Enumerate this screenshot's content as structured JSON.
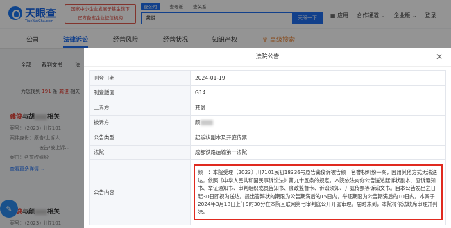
{
  "header": {
    "logo_text": "天眼查",
    "logo_sub": "TianYanCha.com",
    "stamp_line1": "国家中小企业发展子基金旗下",
    "stamp_line2": "官方备案企业征信机构",
    "search_tabs": [
      "查公司",
      "查老板",
      "查关系"
    ],
    "search_value": "龚俊",
    "search_button": "天眼一下",
    "nav": [
      "应用",
      "合作通道",
      "企业版",
      "登录"
    ]
  },
  "main_tabs": [
    "公司",
    "法律诉讼",
    "经营风险",
    "经营状况",
    "知识产权",
    "高级搜索"
  ],
  "left": {
    "filters": [
      "全部",
      "裁判文书",
      "法"
    ],
    "found": {
      "prefix": "为您找到",
      "count": "191",
      "mid": "条",
      "name": "龚俊",
      "suffix": "相关"
    },
    "cards": [
      {
        "title_hl": "龚俊",
        "title_rest": "与胡",
        "title_end": "相关",
        "lines": [
          "案号：（2023）川7101",
          "案件身份：原告/上诉人…",
          "被告/被上诉…",
          "案由：名誉权纠纷"
        ],
        "more": "查看更多详情"
      },
      {
        "title_hl": "龚俊",
        "title_rest": "与颜",
        "title_end": "相关",
        "lines": [
          "案号：（2023）川7101"
        ],
        "more": ""
      }
    ]
  },
  "modal": {
    "title": "法院公告",
    "rows": [
      {
        "label": "刊登日期",
        "value": "2024-01-19"
      },
      {
        "label": "刊登版面",
        "value": "G14"
      },
      {
        "label": "上诉方",
        "value": "龚俊"
      },
      {
        "label": "被诉方",
        "value": "颜"
      },
      {
        "label": "公告类型",
        "value": "起诉状副本及开庭传票"
      },
      {
        "label": "法院",
        "value": "成都铁路运输第一法院"
      }
    ],
    "content_label": "公告内容",
    "content_text": "颜　：本院受理（2023）川7101民初18336号原告龚俊诉被告颜　名誉权纠纷一案，因用其他方式无法送达，依照《中华人民共和国民事诉讼法》第九十五条的规定，本院依法向你公告送达起诉状副本、应诉通知书、举证通知书、审判组织成员告知书、廉政监督卡、诉讼须知、开庭传票等诉讼文书。自本公告发出之日起30日即视为送达。提出答辩状的期限为公告期满后的15日内，举证期限为公告期满后的10日内。本案于2024年3月18日上午9时30分在本院互联网第七审判庭公开开庭审理。届时未到，本院将依法缺席审理并判决。"
  }
}
